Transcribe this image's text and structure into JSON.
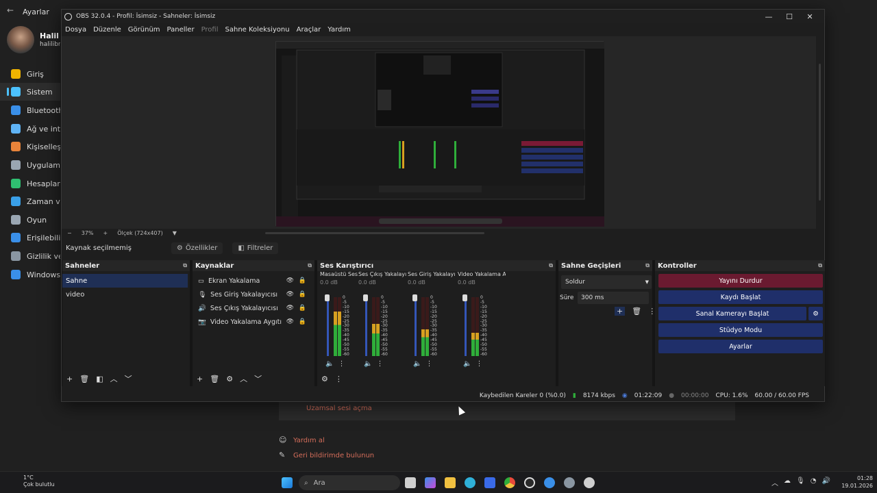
{
  "settings": {
    "title": "Ayarlar",
    "user_name": "Halil İb",
    "user_email": "halilibral",
    "nav": [
      {
        "label": "Giriş",
        "icon": "home-icon",
        "color": "#f0b400"
      },
      {
        "label": "Sistem",
        "icon": "system-icon",
        "color": "#4cc2ff"
      },
      {
        "label": "Bluetooth ve",
        "icon": "bluetooth-icon",
        "color": "#3a8fe8"
      },
      {
        "label": "Ağ ve intern",
        "icon": "network-icon",
        "color": "#5fb3f5"
      },
      {
        "label": "Kişiselleştir",
        "icon": "brush-icon",
        "color": "#e8833a"
      },
      {
        "label": "Uygulamala",
        "icon": "apps-icon",
        "color": "#9aa6b2"
      },
      {
        "label": "Hesaplar",
        "icon": "accounts-icon",
        "color": "#2fbf71"
      },
      {
        "label": "Zaman ve d",
        "icon": "globe-icon",
        "color": "#3aa0e8"
      },
      {
        "label": "Oyun",
        "icon": "gamepad-icon",
        "color": "#9aa6b2"
      },
      {
        "label": "Erişilebilirlik",
        "icon": "accessibility-icon",
        "color": "#3a8fe8"
      },
      {
        "label": "Gizlilik ve gü",
        "icon": "shield-icon",
        "color": "#8a96a2"
      },
      {
        "label": "Windows Up",
        "icon": "update-icon",
        "color": "#3a8fe8"
      }
    ],
    "remote_audio_link": "Uzamsal sesi açma",
    "help_links": [
      "Yardım al",
      "Geri bildirimde bulunun"
    ]
  },
  "obs": {
    "title": "OBS 32.0.4 - Profil: İsimsiz - Sahneler: İsimsiz",
    "menu": [
      "Dosya",
      "Düzenle",
      "Görünüm",
      "Paneller",
      "Profil",
      "Sahne Koleksiyonu",
      "Araçlar",
      "Yardım"
    ],
    "zoom": "37%",
    "scale_label": "Ölçek (724x407)",
    "no_source": "Kaynak seçilmemiş",
    "properties": "Özellikler",
    "filters": "Filtreler",
    "scenes": {
      "title": "Sahneler",
      "items": [
        "Sahne",
        "video"
      ]
    },
    "sources": {
      "title": "Kaynaklar",
      "items": [
        "Ekran Yakalama",
        "Ses Giriş Yakalayıcısı",
        "Ses Çıkış Yakalayıcısı",
        "Video Yakalama Aygıtı"
      ]
    },
    "mixer": {
      "title": "Ses Karıştırıcı",
      "channels": [
        {
          "name": "Masaüstü Ses",
          "db": "0.0 dB",
          "level": 0.75
        },
        {
          "name": "Ses Çıkış Yakalayıcı",
          "db": "0.0 dB",
          "level": 0.55
        },
        {
          "name": "Ses Giriş Yakalayıcı",
          "db": "0.0 dB",
          "level": 0.45
        },
        {
          "name": "Video Yakalama Ay",
          "db": "0.0 dB",
          "level": 0.4
        }
      ],
      "scale": [
        "0",
        "-5",
        "-10",
        "-15",
        "-20",
        "-25",
        "-30",
        "-35",
        "-40",
        "-45",
        "-50",
        "-55",
        "-60"
      ]
    },
    "transitions": {
      "title": "Sahne Geçişleri",
      "selected": "Soldur",
      "duration_label": "Süre",
      "duration": "300 ms"
    },
    "controls": {
      "title": "Kontroller",
      "buttons": [
        "Yayını Durdur",
        "Kaydı Başlat",
        "Sanal Kamerayı Başlat",
        "Stüdyo Modu",
        "Ayarlar"
      ]
    },
    "status": {
      "dropped": "Kaybedilen Kareler 0 (%0.0)",
      "bitrate": "8174 kbps",
      "live_time": "01:22:09",
      "rec_time": "00:00:00",
      "cpu": "CPU: 1.6%",
      "fps": "60.00 / 60.00 FPS"
    }
  },
  "taskbar": {
    "weather_temp": "1°C",
    "weather_desc": "Çok bulutlu",
    "search_placeholder": "Ara",
    "time": "01:28",
    "date": "19.01.2026"
  }
}
